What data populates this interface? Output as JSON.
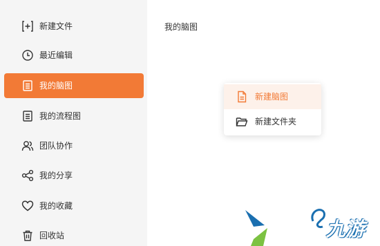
{
  "sidebar": {
    "items": [
      {
        "label": "新建文件",
        "icon": "new-file-icon"
      },
      {
        "label": "最近编辑",
        "icon": "clock-icon"
      },
      {
        "label": "我的脑图",
        "icon": "document-list-icon"
      },
      {
        "label": "我的流程图",
        "icon": "document-list-icon"
      },
      {
        "label": "团队协作",
        "icon": "team-icon"
      },
      {
        "label": "我的分享",
        "icon": "share-icon"
      },
      {
        "label": "我的收藏",
        "icon": "heart-icon"
      },
      {
        "label": "回收站",
        "icon": "trash-icon"
      }
    ],
    "active_index": 2
  },
  "main": {
    "title": "我的脑图"
  },
  "context_menu": {
    "items": [
      {
        "label": "新建脑图",
        "icon": "new-document-icon",
        "highlighted": true
      },
      {
        "label": "新建文件夹",
        "icon": "folder-icon",
        "highlighted": false
      }
    ]
  },
  "watermark": {
    "text": "九游",
    "logo": "jiuyou-logo"
  },
  "colors": {
    "accent": "#f27a36",
    "sidebar_bg": "#f5f5f5",
    "menu_highlight_bg": "#fdf1ea"
  }
}
